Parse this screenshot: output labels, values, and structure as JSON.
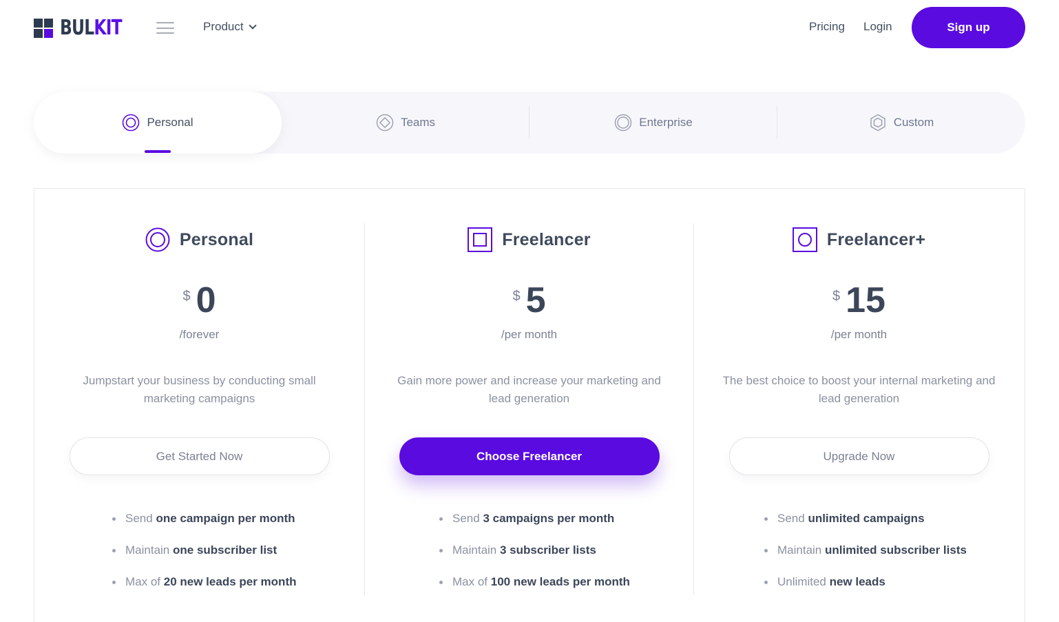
{
  "brand": {
    "logo_main": "BUL",
    "logo_accent": "KIT",
    "accent_color": "#5a0be0",
    "dark_color": "#2e3a4f"
  },
  "nav": {
    "menu_icon": "hamburger-icon",
    "product_label": "Product",
    "pricing_label": "Pricing",
    "login_label": "Login",
    "signup_label": "Sign up"
  },
  "tabs": [
    {
      "label": "Personal",
      "icon": "double-circle-icon",
      "active": true
    },
    {
      "label": "Teams",
      "icon": "diamond-circle-icon",
      "active": false
    },
    {
      "label": "Enterprise",
      "icon": "ring-circle-icon",
      "active": false
    },
    {
      "label": "Custom",
      "icon": "hexagon-icon",
      "active": false
    }
  ],
  "plans": [
    {
      "name": "Personal",
      "icon": "double-circle-icon",
      "currency": "$",
      "amount": "0",
      "period": "/forever",
      "description": "Jumpstart your business by conducting small marketing campaigns",
      "cta": "Get Started Now",
      "cta_style": "outline",
      "features": [
        {
          "pre": "Send",
          "bold": "one campaign per month"
        },
        {
          "pre": "Maintain",
          "bold": "one subscriber list"
        },
        {
          "pre": "Max of",
          "bold": "20 new leads per month"
        }
      ]
    },
    {
      "name": "Freelancer",
      "icon": "square-in-square-icon",
      "currency": "$",
      "amount": "5",
      "period": "/per month",
      "description": "Gain more power and increase your marketing and lead generation",
      "cta": "Choose Freelancer",
      "cta_style": "primary",
      "features": [
        {
          "pre": "Send",
          "bold": "3 campaigns per month"
        },
        {
          "pre": "Maintain",
          "bold": "3 subscriber lists"
        },
        {
          "pre": "Max of",
          "bold": "100 new leads per month"
        }
      ]
    },
    {
      "name": "Freelancer+",
      "icon": "circle-in-square-icon",
      "currency": "$",
      "amount": "15",
      "period": "/per month",
      "description": "The best choice to boost your internal marketing and lead generation",
      "cta": "Upgrade Now",
      "cta_style": "outline",
      "features": [
        {
          "pre": "Send",
          "bold": "unlimited campaigns"
        },
        {
          "pre": "Maintain",
          "bold": "unlimited subscriber lists"
        },
        {
          "pre": "Unlimited",
          "bold": "new leads"
        }
      ]
    }
  ]
}
